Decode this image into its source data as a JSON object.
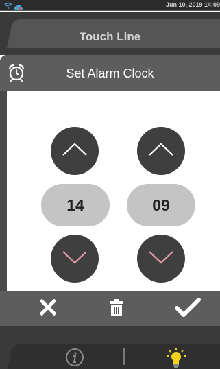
{
  "status_bar": {
    "datetime": "Jun 10, 2019 14:09",
    "icons": [
      "wifi-icon",
      "cloud-icon"
    ]
  },
  "header": {
    "title": "Touch Line"
  },
  "dialog": {
    "title": "Set Alarm Clock",
    "icon": "alarm-clock-icon",
    "hour": {
      "value": "14",
      "up_icon": "chevron-up-icon",
      "down_icon": "chevron-down-icon"
    },
    "minute": {
      "value": "09",
      "up_icon": "chevron-up-icon",
      "down_icon": "chevron-down-icon"
    },
    "footer": [
      "close-icon",
      "trash-icon",
      "checkmark-icon"
    ]
  },
  "bottom_bar": {
    "icons": [
      "info-icon",
      "light-bulb-icon"
    ]
  },
  "colors": {
    "background_dark": "#3a3a3a",
    "panel": "#5d5d5d",
    "button": "#3f3f3f",
    "pill": "#c4c4c4",
    "bulb": "#f2d21b"
  }
}
